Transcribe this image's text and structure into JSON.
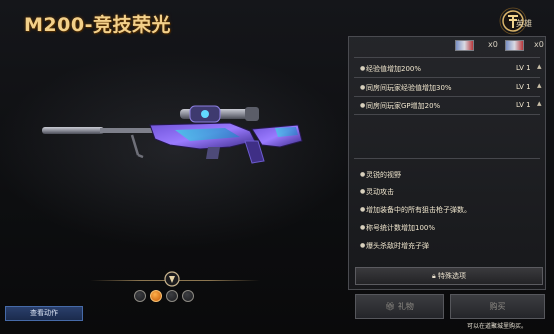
{
  "title": "M200-竞技荣光",
  "logo": {
    "text": "英雄"
  },
  "icons": [
    {
      "name": "coupon-icon",
      "count": "x0"
    },
    {
      "name": "coupon-icon",
      "count": "x0"
    }
  ],
  "bonuses": [
    {
      "text": "经验值增加200%",
      "level": "LV 1"
    },
    {
      "text": "同房间玩家经验值增加30%",
      "level": "LV 1"
    },
    {
      "text": "同房间玩家GP增加20%",
      "level": "LV 1"
    }
  ],
  "features": [
    "灵锐的视野",
    "灵动攻击",
    "增加装备中的所有狙击枪子弹数。",
    "称号统计数增加100%",
    "爆头杀敌时增充子弹"
  ],
  "buttons": {
    "special": "特殊选项",
    "gift": "礼物",
    "buy": "购买",
    "view": "查看动作"
  },
  "note": "可以在道聚城里购买。",
  "skin_selector": {
    "count": 4,
    "active_index": 1
  },
  "colors": {
    "title": "#f3d08a",
    "accent": "#e86f12",
    "panel": "#26272b"
  }
}
